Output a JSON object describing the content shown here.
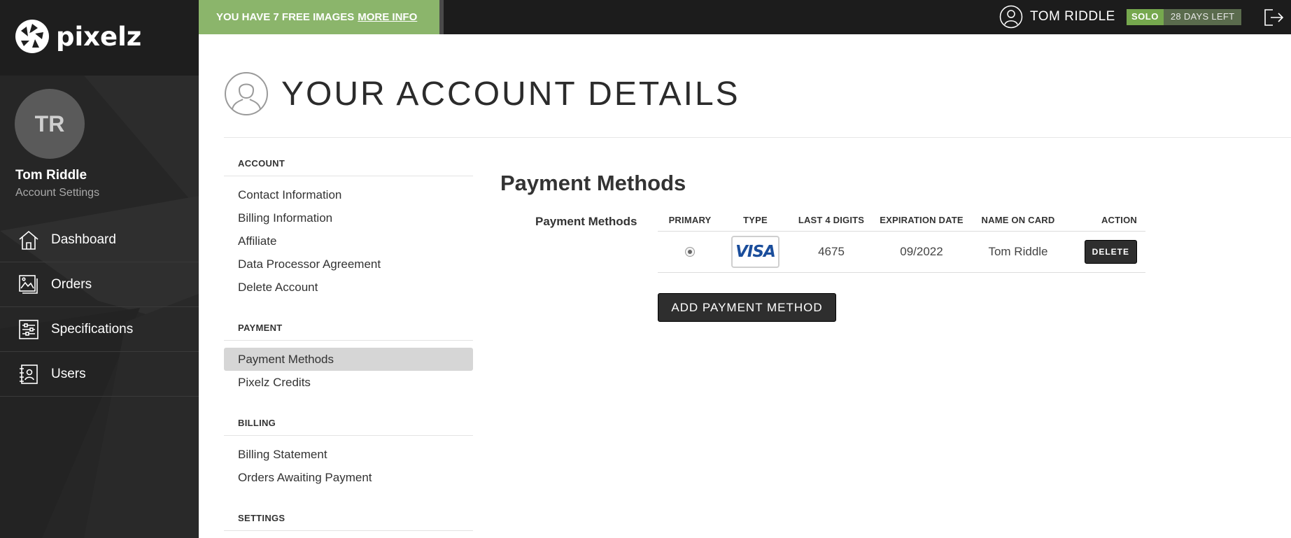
{
  "brand": {
    "name": "pixelz"
  },
  "promo": {
    "text": "YOU HAVE 7 FREE IMAGES",
    "link": "MORE INFO"
  },
  "top_user": {
    "name": "TOM RIDDLE",
    "plan": "SOLO",
    "days_left": "28 DAYS LEFT"
  },
  "sidebar": {
    "avatar_initials": "TR",
    "user_name": "Tom Riddle",
    "user_sub": "Account Settings",
    "items": [
      {
        "label": "Dashboard",
        "icon": "home-icon"
      },
      {
        "label": "Orders",
        "icon": "images-icon"
      },
      {
        "label": "Specifications",
        "icon": "sliders-icon"
      },
      {
        "label": "Users",
        "icon": "contact-book-icon"
      }
    ]
  },
  "page": {
    "title": "YOUR ACCOUNT DETAILS"
  },
  "menu": {
    "account": {
      "heading": "ACCOUNT",
      "items": [
        "Contact Information",
        "Billing Information",
        "Affiliate",
        "Data Processor Agreement",
        "Delete Account"
      ]
    },
    "payment": {
      "heading": "PAYMENT",
      "items": [
        "Payment Methods",
        "Pixelz Credits"
      ],
      "active": "Payment Methods"
    },
    "billing": {
      "heading": "BILLING",
      "items": [
        "Billing Statement",
        "Orders Awaiting Payment"
      ]
    },
    "settings": {
      "heading": "SETTINGS"
    }
  },
  "main": {
    "section_title": "Payment Methods",
    "table_label": "Payment Methods",
    "columns": [
      "PRIMARY",
      "TYPE",
      "LAST 4 DIGITS",
      "EXPIRATION DATE",
      "NAME ON CARD",
      "ACTION"
    ],
    "rows": [
      {
        "primary": true,
        "type": "VISA",
        "last4": "4675",
        "expiration": "09/2022",
        "name": "Tom Riddle",
        "action": "DELETE"
      }
    ],
    "add_button": "ADD PAYMENT METHOD"
  },
  "colors": {
    "promo_bg": "#8bb56b",
    "sidebar_bg": "#262626",
    "topbar_bg": "#1c1c1c",
    "plan_green": "#76a84e",
    "button_dark": "#2e2e2e"
  }
}
